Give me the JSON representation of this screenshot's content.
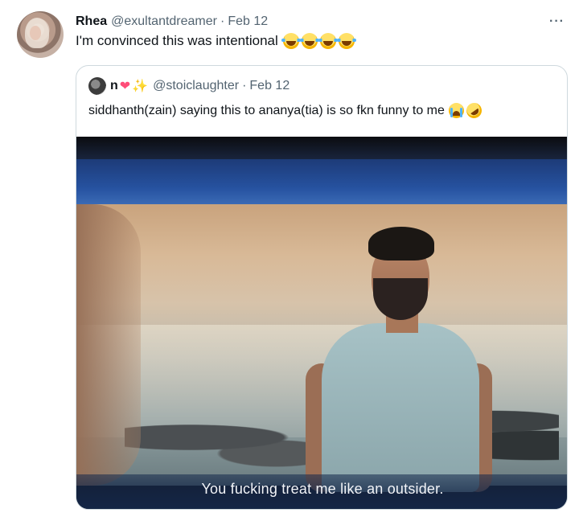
{
  "tweet": {
    "author_name": "Rhea",
    "author_handle": "@exultantdreamer",
    "separator": "·",
    "date": "Feb 12",
    "text": "I'm convinced this was intentional",
    "emojis": [
      "face-with-tears-of-joy",
      "face-with-tears-of-joy",
      "face-with-tears-of-joy",
      "face-with-tears-of-joy"
    ],
    "more_label": "···"
  },
  "quoted_tweet": {
    "author_name": "n",
    "name_emojis": [
      "heart",
      "sparkles"
    ],
    "author_handle": "@stoiclaughter",
    "separator": "·",
    "date": "Feb 12",
    "text": "siddhanth(zain) saying this to ananya(tia) is so fkn funny to me",
    "text_emojis": [
      "loudly-crying-face",
      "rolling-on-the-floor-laughing"
    ],
    "media": {
      "subtitle": "You fucking treat me like an outsider."
    }
  },
  "colors": {
    "primary_text": "#0f1419",
    "secondary_text": "#536471",
    "border": "#cfd9de"
  }
}
